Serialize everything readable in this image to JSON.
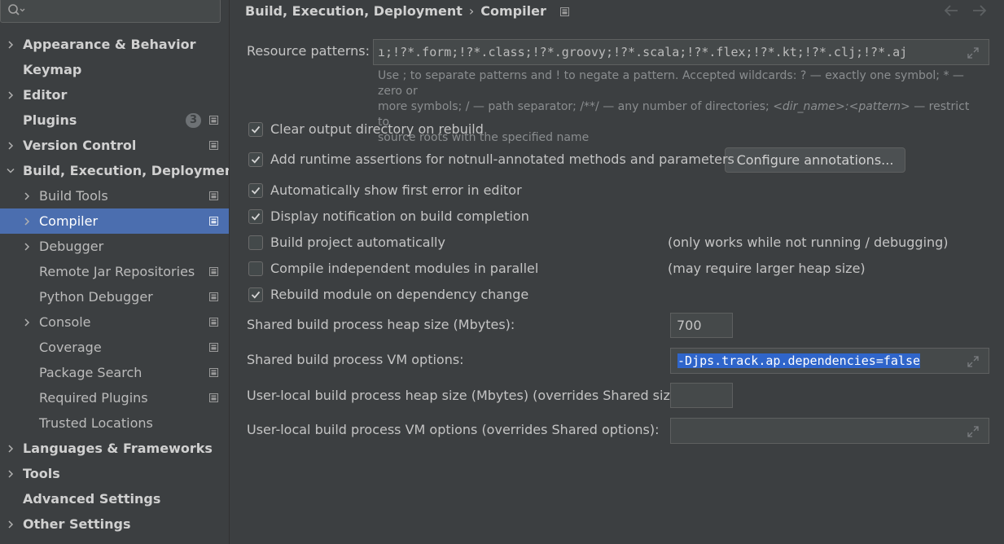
{
  "sidebar": {
    "search_placeholder": "",
    "items": [
      {
        "label": "Appearance & Behavior",
        "level": 0,
        "chevron": "right"
      },
      {
        "label": "Keymap",
        "level": 0,
        "chevron": null
      },
      {
        "label": "Editor",
        "level": 0,
        "chevron": "right"
      },
      {
        "label": "Plugins",
        "level": 0,
        "chevron": null,
        "badge": "3",
        "project_icon": true
      },
      {
        "label": "Version Control",
        "level": 0,
        "chevron": "right",
        "project_icon": true
      },
      {
        "label": "Build, Execution, Deployment",
        "level": 0,
        "chevron": "down"
      },
      {
        "label": "Build Tools",
        "level": 1,
        "chevron": "right",
        "project_icon": true
      },
      {
        "label": "Compiler",
        "level": 1,
        "chevron": "right",
        "project_icon": true,
        "selected": true
      },
      {
        "label": "Debugger",
        "level": 1,
        "chevron": "right"
      },
      {
        "label": "Remote Jar Repositories",
        "level": 1,
        "chevron": null,
        "project_icon": true
      },
      {
        "label": "Python Debugger",
        "level": 1,
        "chevron": null,
        "project_icon": true
      },
      {
        "label": "Console",
        "level": 1,
        "chevron": "right",
        "project_icon": true
      },
      {
        "label": "Coverage",
        "level": 1,
        "chevron": null,
        "project_icon": true
      },
      {
        "label": "Package Search",
        "level": 1,
        "chevron": null,
        "project_icon": true
      },
      {
        "label": "Required Plugins",
        "level": 1,
        "chevron": null,
        "project_icon": true
      },
      {
        "label": "Trusted Locations",
        "level": 1,
        "chevron": null
      },
      {
        "label": "Languages & Frameworks",
        "level": 0,
        "chevron": "right"
      },
      {
        "label": "Tools",
        "level": 0,
        "chevron": "right"
      },
      {
        "label": "Advanced Settings",
        "level": 0,
        "chevron": null
      },
      {
        "label": "Other Settings",
        "level": 0,
        "chevron": "right"
      }
    ]
  },
  "breadcrumb": {
    "parent": "Build, Execution, Deployment",
    "separator": "›",
    "current": "Compiler"
  },
  "resource_patterns": {
    "label": "Resource patterns:",
    "value": "ı;!?*.form;!?*.class;!?*.groovy;!?*.scala;!?*.flex;!?*.kt;!?*.clj;!?*.aj"
  },
  "hint": {
    "line1": "Use ; to separate patterns and ! to negate a pattern. Accepted wildcards: ? — exactly one symbol; * — zero or",
    "line2a": "more symbols; / — path separator; /**/ — any number of directories;",
    "line2_dir": "<dir_name>:<pattern>",
    "line2b": "— restrict to",
    "line3": "source roots with the specified name"
  },
  "checkboxes": [
    {
      "label": "Clear output directory on rebuild",
      "checked": true
    },
    {
      "label": "Add runtime assertions for notnull-annotated methods and parameters",
      "checked": true
    },
    {
      "label": "Automatically show first error in editor",
      "checked": true
    },
    {
      "label": "Display notification on build completion",
      "checked": true
    },
    {
      "label": "Build project automatically",
      "checked": false,
      "note": "(only works while not running / debugging)"
    },
    {
      "label": "Compile independent modules in parallel",
      "checked": false,
      "note": "(may require larger heap size)"
    },
    {
      "label": "Rebuild module on dependency change",
      "checked": true
    }
  ],
  "configure_button": "Configure annotations...",
  "heap_size": {
    "label": "Shared build process heap size (Mbytes):",
    "value": "700"
  },
  "vm_options": {
    "label": "Shared build process VM options:",
    "value": "-Djps.track.ap.dependencies=false"
  },
  "user_heap": {
    "label": "User-local build process heap size (Mbytes) (overrides Shared size):",
    "value": ""
  },
  "user_vm": {
    "label": "User-local build process VM options (overrides Shared options):",
    "value": ""
  },
  "colors": {
    "background": "#3c3f41",
    "selection": "#4b6eaf",
    "text_selection": "#2f65ca",
    "text": "#bbbbbb"
  }
}
